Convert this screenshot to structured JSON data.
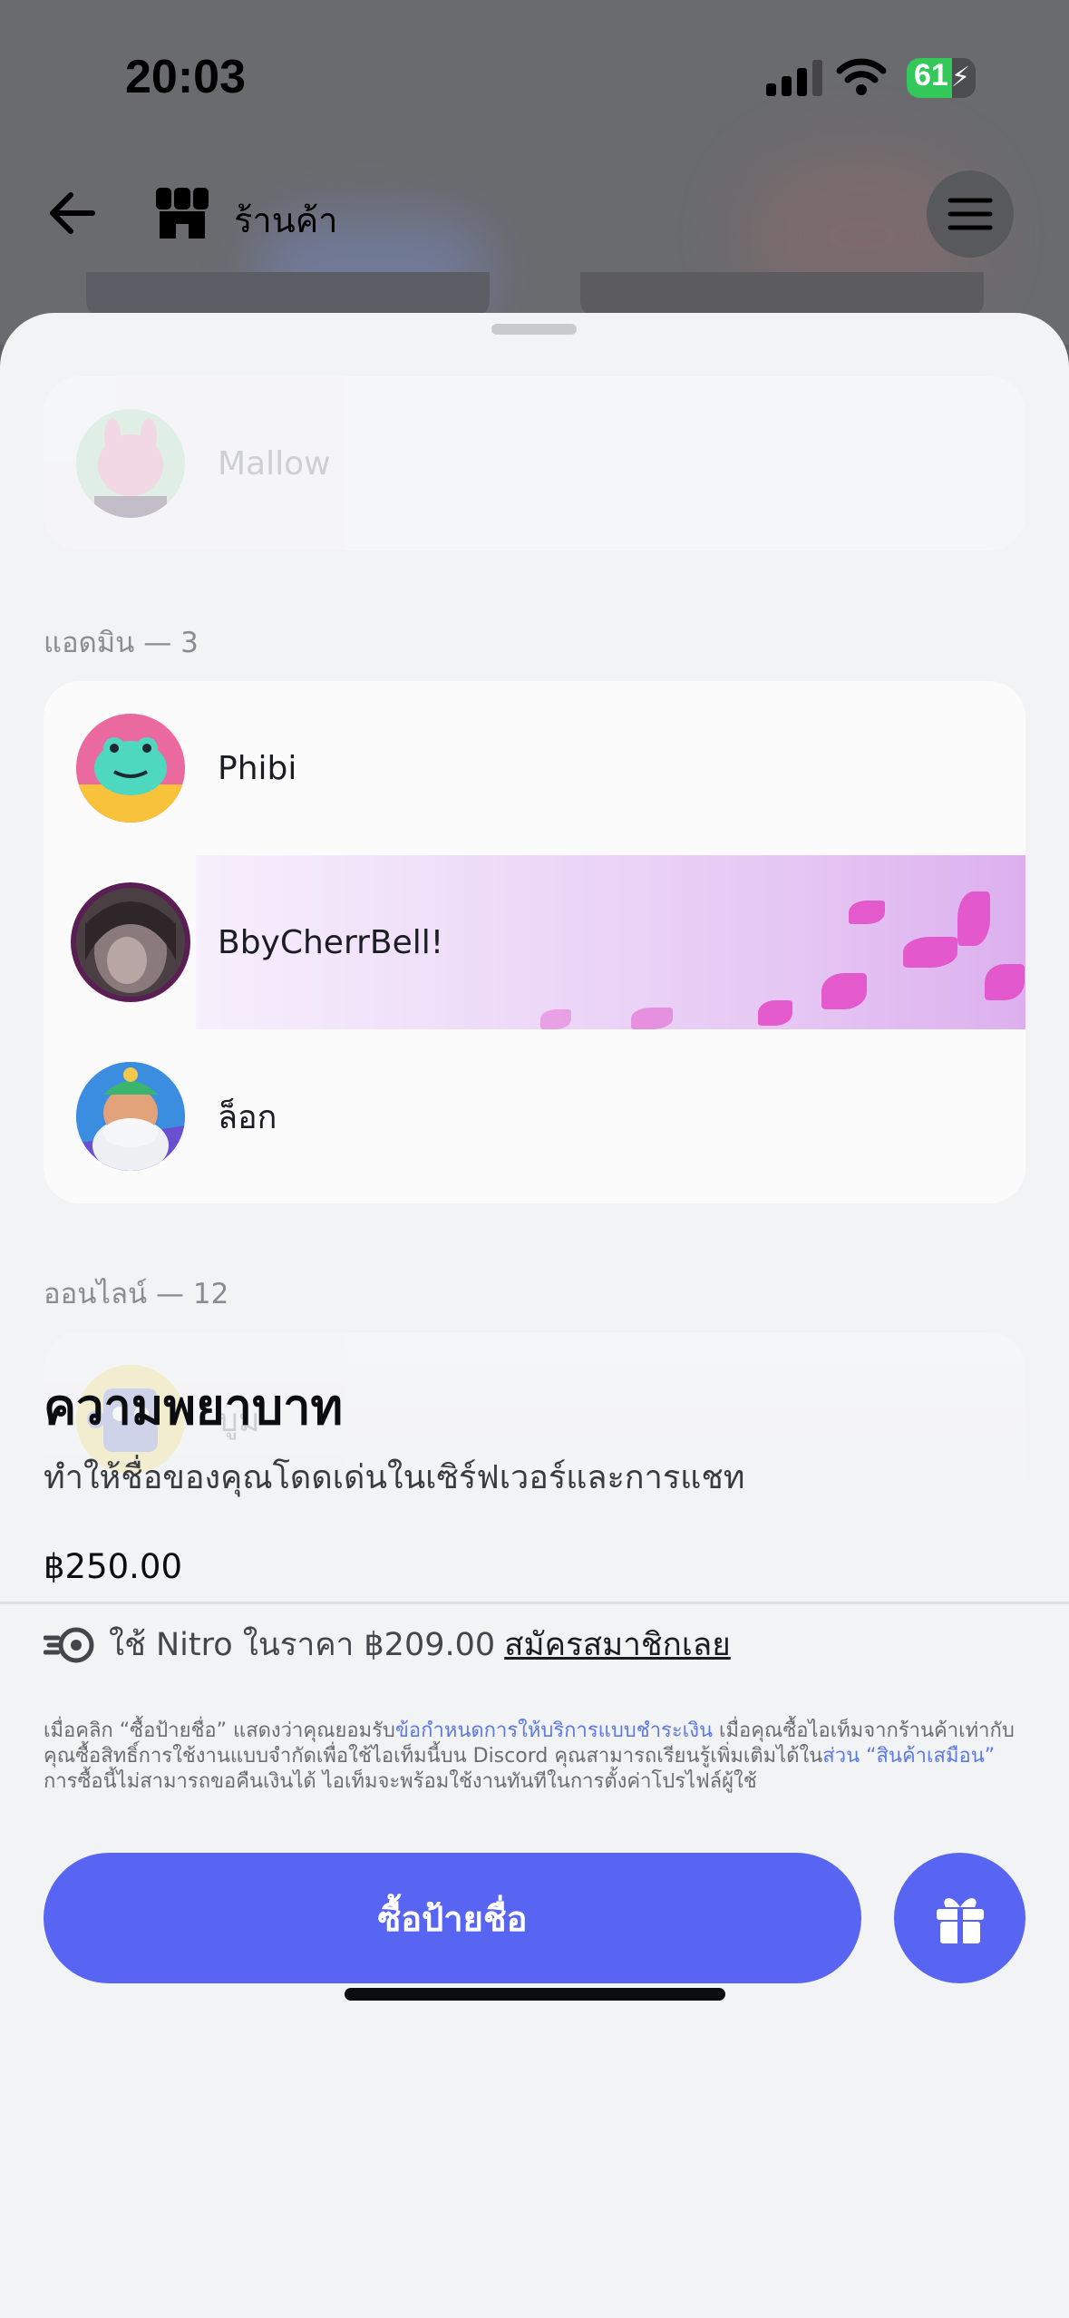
{
  "status_bar": {
    "time": "20:03",
    "battery": "61"
  },
  "header": {
    "title": "ร้านค้า"
  },
  "icons": {
    "back": "back-arrow-icon",
    "shop": "shop-icon",
    "menu": "menu-icon",
    "signal": "signal-icon",
    "wifi": "wifi-icon",
    "battery": "battery-icon",
    "nitro": "nitro-icon",
    "gift": "gift-icon"
  },
  "members": {
    "top_member": {
      "name": "Mallow"
    },
    "admin_section": {
      "label": "แอดมิน — 3"
    },
    "admins": [
      {
        "name": "Phibi"
      },
      {
        "name": "BbyCherrBell!"
      },
      {
        "name": "ล็อก"
      }
    ],
    "online_section": {
      "label": "ออนไลน์ — 12"
    },
    "online": [
      {
        "name": "บูม"
      }
    ]
  },
  "product": {
    "title": "ความพยาบาท",
    "subtitle": "ทำให้ชื่อของคุณโดดเด่นในเซิร์ฟเวอร์และการแชท",
    "price": "฿250.00",
    "nitro_text": "ใช้ Nitro ในราคา ฿209.00",
    "nitro_link": "สมัครสมาชิกเลย",
    "legal_1": "เมื่อคลิก “ซื้อป้ายชื่อ” แสดงว่าคุณยอมรับ",
    "legal_link_1": "ข้อกำหนดการให้บริการแบบชำระเงิน",
    "legal_2": " เมื่อคุณซื้อไอเท็มจากร้านค้าเท่ากับคุณซื้อสิทธิ์การใช้งานแบบจำกัดเพื่อใช้ไอเท็มนี้บน Discord คุณสามารถเรียนรู้เพิ่มเติมได้ใน",
    "legal_link_2": "ส่วน “สินค้าเสมือน”",
    "legal_3": " การซื้อนี้ไม่สามารถขอคืนเงินได้ ไอเท็มจะพร้อมใช้งานทันทีในการตั้งค่าโปรไฟล์ผู้ใช้",
    "buy_label": "ซื้อป้ายชื่อ"
  },
  "colors": {
    "accent": "#5865f2",
    "sheet_bg": "#f2f3f5",
    "nameplate_pink": "#e34fc9"
  }
}
